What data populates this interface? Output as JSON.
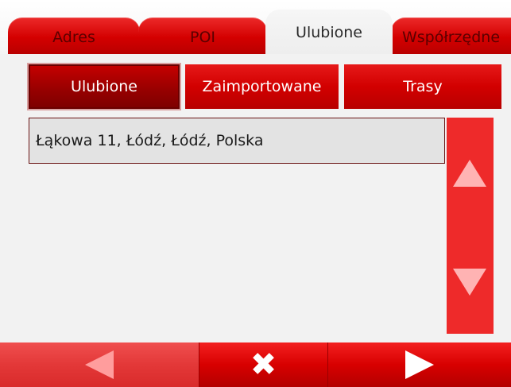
{
  "tabs": [
    {
      "label": "Adres",
      "active": false
    },
    {
      "label": "POI",
      "active": false
    },
    {
      "label": "Ulubione",
      "active": true
    },
    {
      "label": "Współrzędne",
      "active": false
    }
  ],
  "subtabs": [
    {
      "label": "Ulubione",
      "selected": true
    },
    {
      "label": "Zaimportowane",
      "selected": false
    },
    {
      "label": "Trasy",
      "selected": false
    }
  ],
  "list": {
    "items": [
      "Łąkowa 11, Łódź, Łódź, Polska"
    ]
  },
  "scroll": {
    "up_icon": "triangle-up",
    "down_icon": "triangle-down"
  },
  "bottom": {
    "back_icon": "arrow-left",
    "cancel_icon": "close-x",
    "cancel_glyph": "✖",
    "next_icon": "arrow-right"
  },
  "colors": {
    "accent": "#d40000",
    "accent_dark": "#8a0000",
    "background": "#f2f2f2",
    "list_item_bg": "#e3e3e3"
  }
}
